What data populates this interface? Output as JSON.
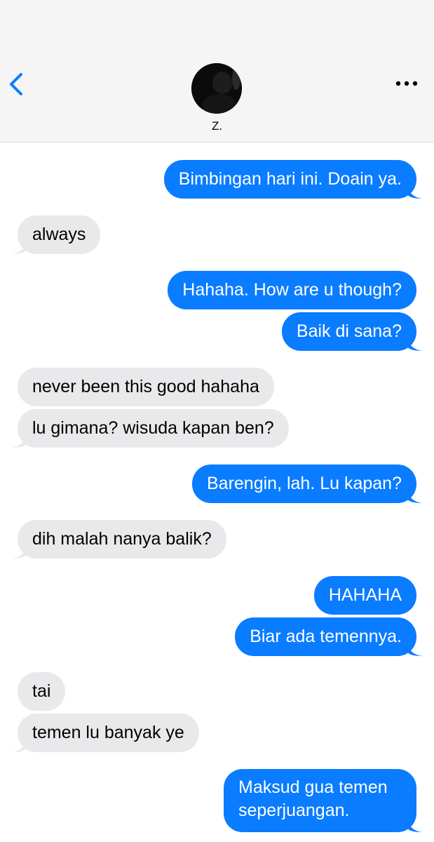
{
  "header": {
    "contact_name": "Z.",
    "back_icon": "chevron-left-icon",
    "more_icon": "ellipsis-icon",
    "accent_color": "#0a7cff"
  },
  "colors": {
    "sent_bubble": "#0a7cff",
    "received_bubble": "#e9e9eb",
    "header_bg": "#f5f5f5"
  },
  "messages": [
    {
      "from": "me",
      "text": "Bimbingan hari ini. Doain ya."
    },
    {
      "from": "them",
      "text": "always"
    },
    {
      "from": "me",
      "text": "Hahaha. How are u though?"
    },
    {
      "from": "me",
      "text": "Baik di sana?"
    },
    {
      "from": "them",
      "text": "never been this good hahaha"
    },
    {
      "from": "them",
      "text": "lu gimana? wisuda kapan ben?"
    },
    {
      "from": "me",
      "text": "Barengin, lah. Lu kapan?"
    },
    {
      "from": "them",
      "text": "dih malah nanya balik?"
    },
    {
      "from": "me",
      "text": "HAHAHA"
    },
    {
      "from": "me",
      "text": "Biar ada temennya."
    },
    {
      "from": "them",
      "text": "tai"
    },
    {
      "from": "them",
      "text": "temen lu banyak ye"
    },
    {
      "from": "me",
      "text": "Maksud gua temen seperjuangan."
    }
  ]
}
